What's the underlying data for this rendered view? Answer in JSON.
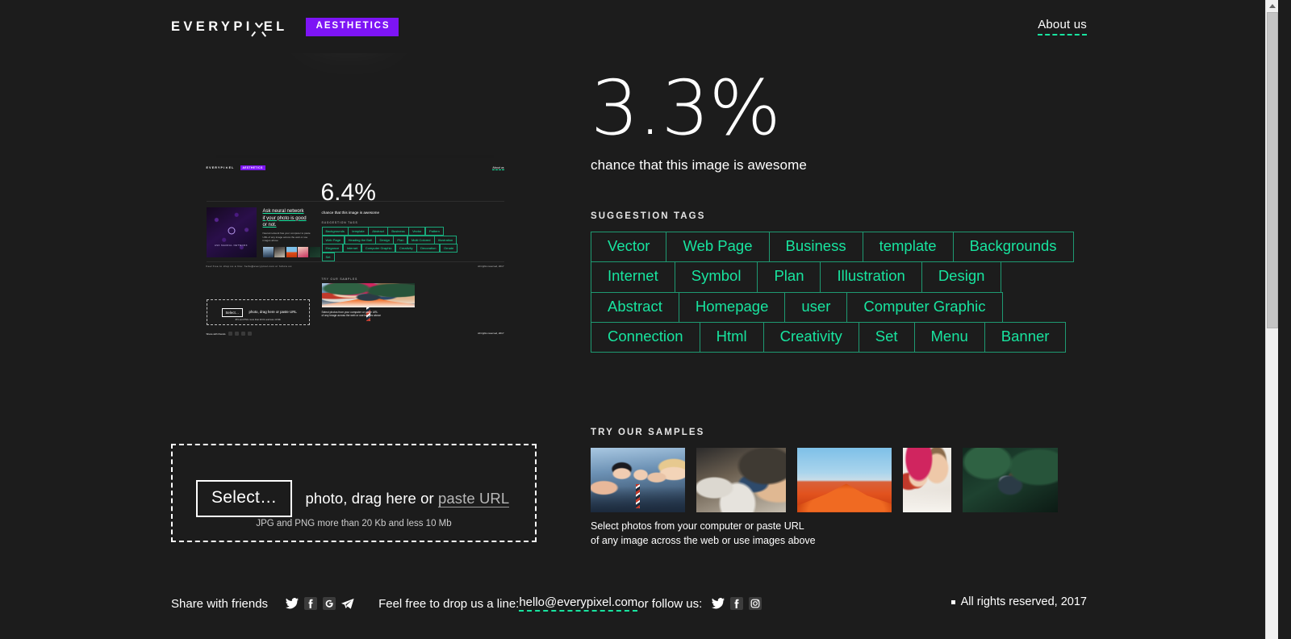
{
  "header": {
    "logo_text_pre": "EVERYPI",
    "logo_text_post": "EL",
    "badge": "AESTHETICS",
    "about_link": "About us"
  },
  "result": {
    "score": "3.3%",
    "score_caption": "chance that this image is awesome",
    "tags_label": "SUGGESTION TAGS",
    "tags": [
      "Vector",
      "Web Page",
      "Business",
      "template",
      "Backgrounds",
      "Internet",
      "Symbol",
      "Plan",
      "Illustration",
      "Design",
      "Abstract",
      "Homepage",
      "user",
      "Computer Graphic",
      "Connection",
      "Html",
      "Creativity",
      "Set",
      "Menu",
      "Banner"
    ]
  },
  "samples": {
    "label": "TRY OUR SAMPLES",
    "items": [
      {
        "name": "business-team-photo"
      },
      {
        "name": "desk-laptop-meeting-photo"
      },
      {
        "name": "orange-sand-dune-photo"
      },
      {
        "name": "couple-winter-hats-photo"
      },
      {
        "name": "couple-forest-photo"
      }
    ],
    "note_line1": "Select photos from your computer or paste URL",
    "note_line2": "of any image across the web or use images above"
  },
  "dropzone": {
    "select_label": "Select…",
    "text_before": "photo, drag here or ",
    "url_label": "paste URL",
    "hint": "JPG and PNG more than 20 Kb and less 10 Mb"
  },
  "footer": {
    "share_label": "Share with friends",
    "share_icons": [
      "twitter-icon",
      "facebook-icon",
      "google-plus-icon",
      "telegram-icon"
    ],
    "line_prefix": "Feel free to drop us a line: ",
    "email": "hello@everypixel.com",
    "line_suffix": " or follow us:",
    "follow_icons": [
      "twitter-icon",
      "facebook-icon",
      "instagram-icon"
    ],
    "copyright": "All rights reserved, 2017"
  },
  "preview": {
    "alt": "uploaded-screenshot-of-everypixel-aesthetics-page",
    "inner": {
      "logo_pre": "EVERYPI",
      "logo_post": "EL",
      "badge": "AESTHETICS",
      "about": "About us",
      "score": "6.4%",
      "score_caption": "chance that this image is awesome",
      "tags_label": "SUGGESTION TAGS",
      "tags": [
        "Backgrounds",
        "template",
        "Abstract",
        "Business",
        "Vector",
        "Pattern",
        "Web Page",
        "Heading the Ball",
        "Design",
        "Plan",
        "Multi Colored",
        "Illustration",
        "Elegance",
        "Internet",
        "Computer Graphic",
        "Creativity",
        "Decoration",
        "Ornate",
        "Set"
      ],
      "samples_label": "TRY OUR SAMPLES",
      "samples_note1": "Select photos from your computer or paste URL",
      "samples_note2": "of any image across the web or use images above",
      "card_caption": "ASK NEURAL NETWORK",
      "headline_l1": "Ask neural network",
      "headline_l2": "if your photo is good",
      "headline_l3": "or not.",
      "body_text": "Neural network has your computer to paste URL of any image across the web or use images above",
      "select_label": "Select…",
      "drop_text": "photo, drag here or paste URL",
      "drop_hint": "JPG and PNG more than 20 Kb and less 10 Mb",
      "share_label": "Share with friends",
      "footer_line": "Feel free to drop us a line: hello@everypixel.com or follow us:",
      "copyright": "All rights reserved, 2017"
    }
  },
  "scrollbar": {
    "name": "vertical-scrollbar"
  },
  "colors": {
    "background": "#1c1c1c",
    "accent_teal": "#18e49f",
    "accent_purple": "#7d14f5",
    "text": "#ffffff"
  }
}
